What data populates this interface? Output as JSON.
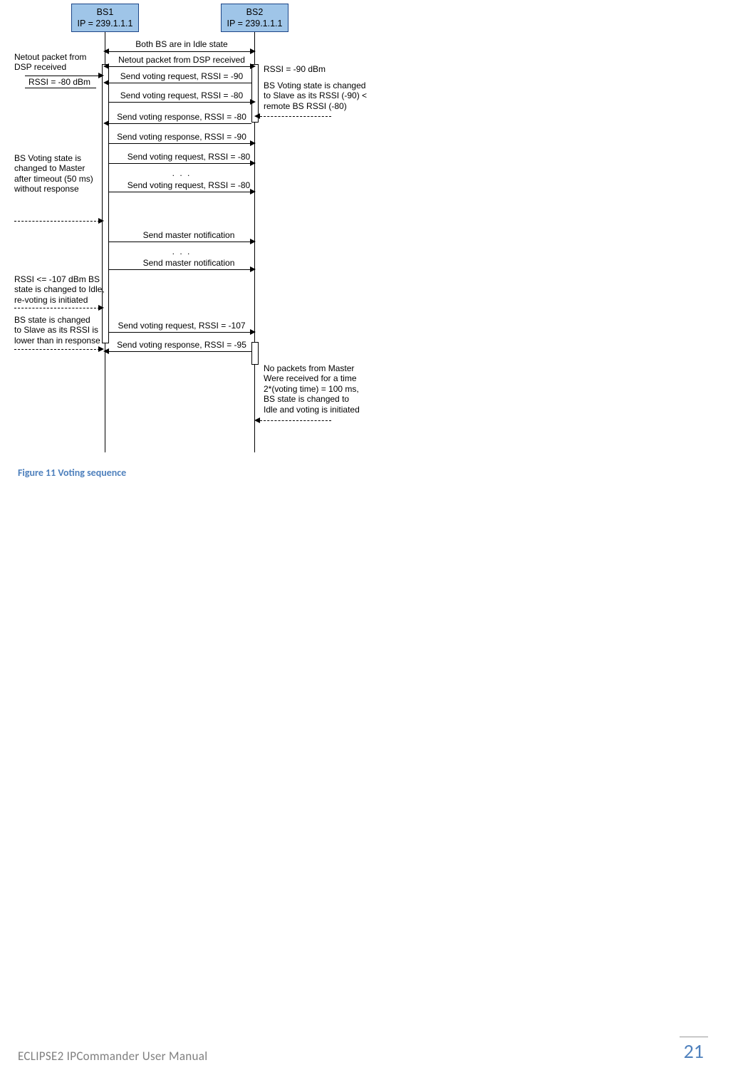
{
  "bs1": {
    "name": "BS1",
    "ip": "IP = 239.1.1.1"
  },
  "bs2": {
    "name": "BS2",
    "ip": "IP = 239.1.1.1"
  },
  "messages": {
    "m0": "Both BS are in Idle state",
    "m1": "Netout packet from DSP received",
    "m2": "RSSI = -80 dBm",
    "m3": "Send voting request, RSSI = -90",
    "m4": "Send voting request, RSSI = -80",
    "m5": "Send voting response, RSSI = -80",
    "m6": "Send voting response, RSSI = -90",
    "m7": "Send voting request, RSSI = -80",
    "m8": ". . .",
    "m9": "Send voting request, RSSI = -80",
    "m10": "Send master notification",
    "m11": ". . .",
    "m12": "Send master notification",
    "m13": "Send voting request, RSSI = -107",
    "m14": "Send voting response, RSSI = -95"
  },
  "notes": {
    "n_left1": "Netout packet from\nDSP received",
    "n_right1": "RSSI = -90 dBm",
    "n_right2": "BS Voting state is changed\nto Slave as its RSSI (-90) <\nremote BS RSSI (-80)",
    "n_left2": "BS Voting state is\nchanged to Master\nafter timeout (50 ms)\nwithout response",
    "n_left3": "RSSI <= -107 dBm BS\nstate is changed to Idle,\nre-voting is initiated",
    "n_left4": "BS state is changed\nto Slave as its RSSI is\nlower than in response",
    "n_right3": "No packets from Master\nWere received for a time\n2*(voting time) = 100 ms,\nBS state is changed to\nIdle and voting is initiated"
  },
  "caption": "Figure 11 Voting sequence",
  "footer_title": "ECLIPSE2 IPCommander User Manual",
  "page_number": "21"
}
